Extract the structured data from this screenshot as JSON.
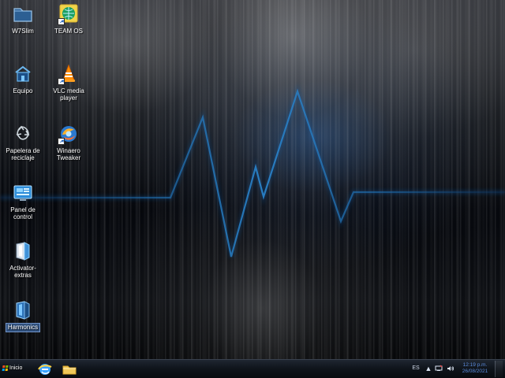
{
  "desktop": {
    "icons": [
      {
        "label": "W7Slim"
      },
      {
        "label": "TEAM OS"
      },
      {
        "label": "Equipo"
      },
      {
        "label": "VLC media player"
      },
      {
        "label": "Papelera de reciclaje"
      },
      {
        "label": "Winaero Tweaker"
      },
      {
        "label": "Panel de control"
      },
      {
        "label": "Activator-extras"
      },
      {
        "label": "Harmonics"
      }
    ]
  },
  "taskbar": {
    "start_label": "Inicio",
    "pinned_apps": [
      {
        "icon": "internet-explorer-icon"
      },
      {
        "icon": "file-explorer-icon"
      }
    ],
    "tray": {
      "language": "ES",
      "show_hidden_icon": "▲",
      "network_icon": "network-icon",
      "volume_icon": "volume-icon",
      "time": "12:19 p.m.",
      "date": "26/08/2021"
    }
  },
  "colors": {
    "accent_blue": "#2f73d9",
    "waveform_blue": "#1d6fb3",
    "clock_blue": "#5b8bdc",
    "taskbar_dark": "#0c1117"
  }
}
